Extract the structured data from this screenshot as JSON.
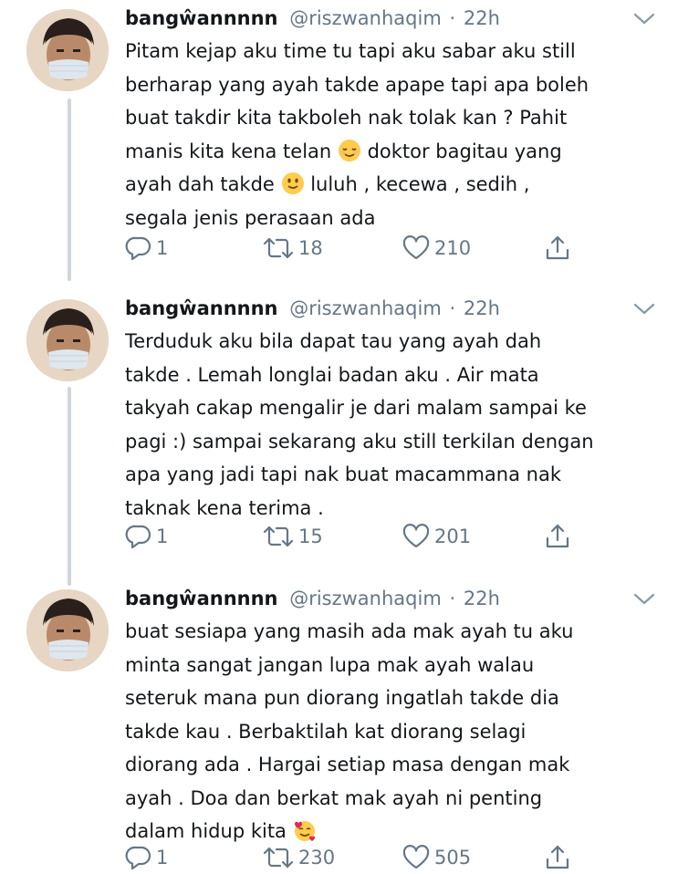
{
  "tweets": [
    {
      "display_name": "bangŵannnnn",
      "handle": "@riszwanhaqim",
      "separator": "·",
      "time": "22h",
      "lines": [
        "Pitam kejap aku time tu tapi aku sabar aku still",
        "berharap yang ayah takde apape tapi apa boleh",
        "buat takdir kita takboleh nak tolak kan ? Pahit",
        "manis kita kena telan ",
        " doktor bagitau yang",
        "ayah dah takde ",
        " luluh , kecewa , sedih ,",
        "segala jenis perasaan ada"
      ],
      "reply_count": "1",
      "retweet_count": "18",
      "like_count": "210"
    },
    {
      "display_name": "bangŵannnnn",
      "handle": "@riszwanhaqim",
      "separator": "·",
      "time": "22h",
      "text": "Terduduk aku bila dapat tau yang ayah dah\ntakde . Lemah longlai badan aku . Air mata\ntakyah cakap mengalir je dari malam sampai ke\npagi :) sampai sekarang aku still terkilan dengan\napa yang jadi tapi nak buat macammana nak\ntaknak kena terima .",
      "reply_count": "1",
      "retweet_count": "15",
      "like_count": "201"
    },
    {
      "display_name": "bangŵannnnn",
      "handle": "@riszwanhaqim",
      "separator": "·",
      "time": "22h",
      "text": "buat sesiapa yang masih ada mak ayah tu aku\nminta sangat jangan lupa mak ayah walau\nseteruk mana pun diorang ingatlah takde dia\ntakde kau . Berbaktilah kat diorang selagi\ndiorang ada . Hargai setiap masa dengan mak\nayah . Doa dan berkat mak ayah ni penting\ndalam hidup kita ",
      "reply_count": "1",
      "retweet_count": "230",
      "like_count": "505"
    }
  ],
  "icons": {
    "reply": "reply-icon",
    "retweet": "retweet-icon",
    "like": "heart-icon",
    "share": "share-icon",
    "menu": "chevron-down-icon",
    "emoji_1": "relieved-face-emoji",
    "emoji_2": "slightly-smiling-face-emoji",
    "emoji_3": "smiling-face-with-hearts-emoji"
  },
  "colors": {
    "text": "#14171a",
    "secondary": "#657786",
    "thread_line": "#ccd6dd"
  }
}
